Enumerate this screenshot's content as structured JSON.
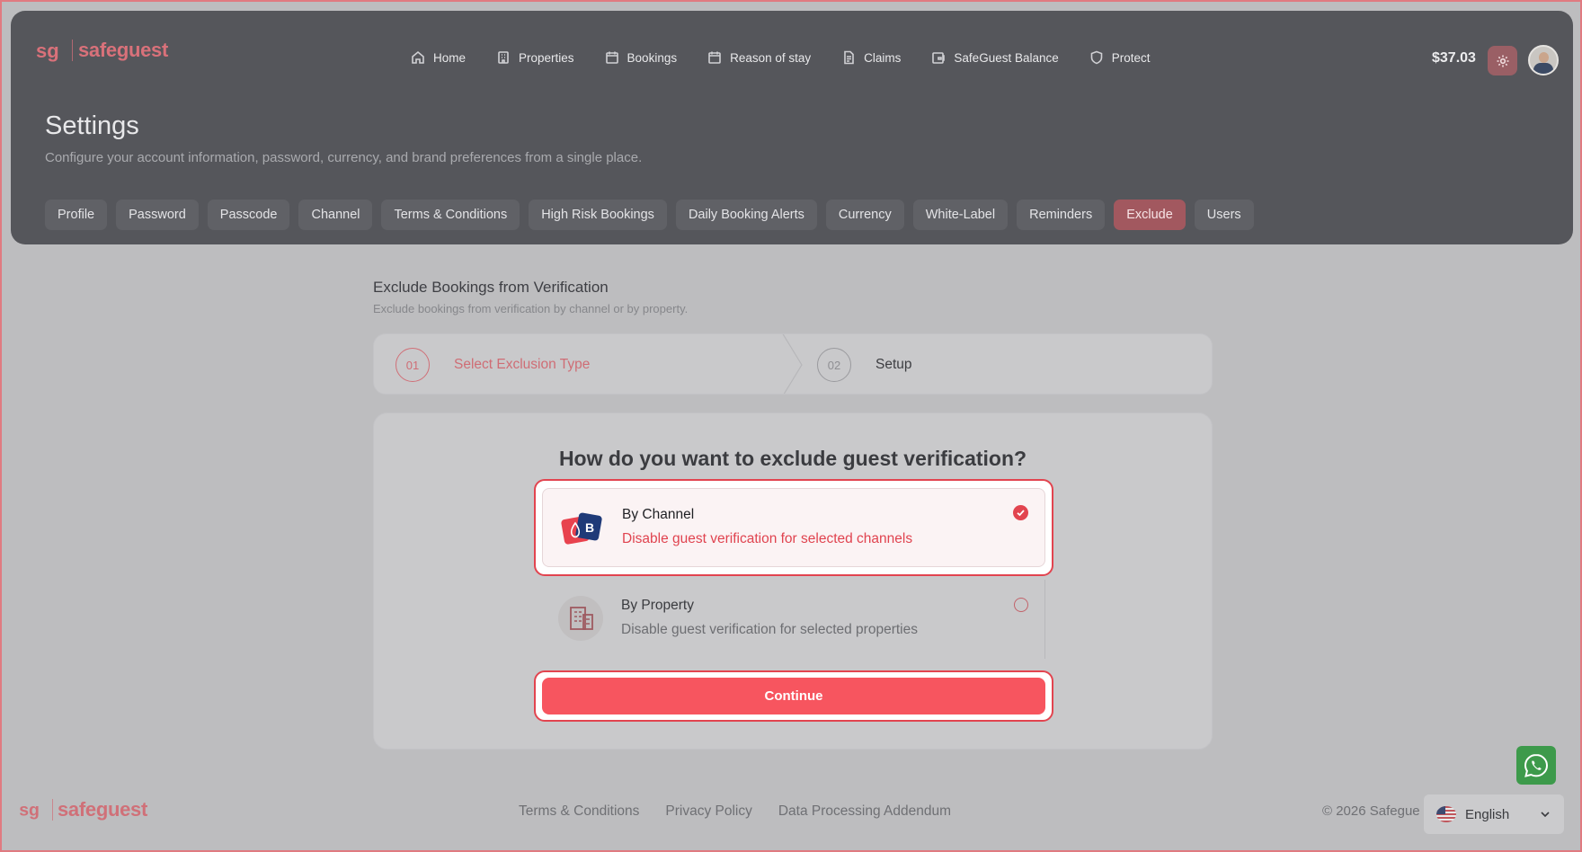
{
  "brand": {
    "name": "safeguest"
  },
  "nav": [
    {
      "label": "Home",
      "icon": "home-icon"
    },
    {
      "label": "Properties",
      "icon": "building-icon"
    },
    {
      "label": "Bookings",
      "icon": "calendar-icon"
    },
    {
      "label": "Reason of stay",
      "icon": "calendar-icon"
    },
    {
      "label": "Claims",
      "icon": "document-icon"
    },
    {
      "label": "SafeGuest Balance",
      "icon": "wallet-icon"
    },
    {
      "label": "Protect",
      "icon": "shield-icon"
    }
  ],
  "header": {
    "balance": "$37.03"
  },
  "page": {
    "title": "Settings",
    "subtitle": "Configure your account information, password, currency, and brand preferences from a single place."
  },
  "tabs": [
    {
      "label": "Profile"
    },
    {
      "label": "Password"
    },
    {
      "label": "Passcode"
    },
    {
      "label": "Channel"
    },
    {
      "label": "Terms & Conditions"
    },
    {
      "label": "High Risk Bookings"
    },
    {
      "label": "Daily Booking Alerts"
    },
    {
      "label": "Currency"
    },
    {
      "label": "White-Label"
    },
    {
      "label": "Reminders"
    },
    {
      "label": "Exclude",
      "active": true
    },
    {
      "label": "Users"
    }
  ],
  "section": {
    "title": "Exclude Bookings from Verification",
    "subtitle": "Exclude bookings from verification by channel or by property."
  },
  "steps": [
    {
      "number": "01",
      "label": "Select Exclusion Type"
    },
    {
      "number": "02",
      "label": "Setup"
    }
  ],
  "question": "How do you want to exclude guest verification?",
  "options": [
    {
      "title": "By Channel",
      "description": "Disable guest verification for selected channels",
      "selected": true
    },
    {
      "title": "By Property",
      "description": "Disable guest verification for selected properties",
      "selected": false
    }
  ],
  "continue_label": "Continue",
  "footer": {
    "links": [
      "Terms & Conditions",
      "Privacy Policy",
      "Data Processing Addendum"
    ],
    "copyright": "© 2026 Safegue"
  },
  "language": {
    "label": "English"
  },
  "colors": {
    "accent": "#f7555f",
    "header_bg": "#55565b",
    "active_tab": "#a2585f",
    "whatsapp": "#3d9a4b"
  }
}
